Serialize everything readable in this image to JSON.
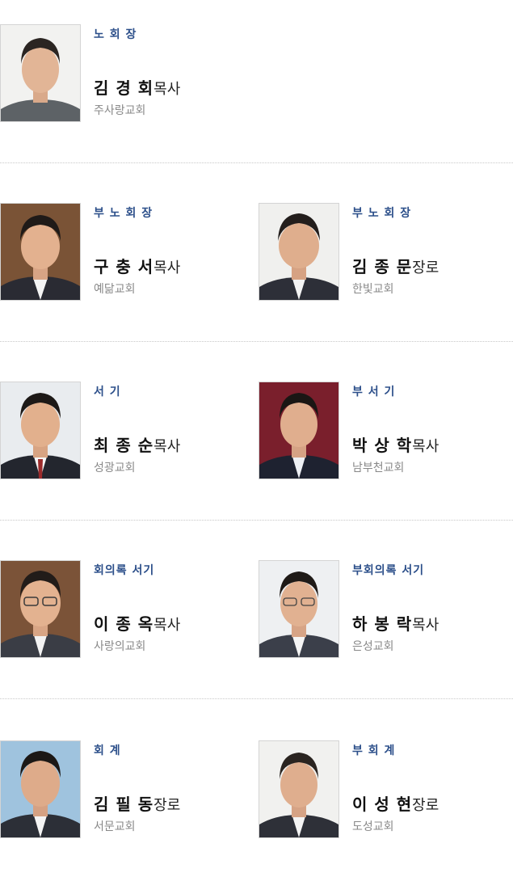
{
  "colors": {
    "role": "#2c4f8a",
    "name": "#111111",
    "church": "#888888",
    "divider": "#c8c8c8"
  },
  "officers": [
    {
      "role": "노 회 장",
      "name": "김 경 회",
      "title": "목사",
      "church": "주사랑교회",
      "photo": "portrait-photo"
    },
    {
      "role": "부 노 회 장",
      "name": "구 충 서",
      "title": "목사",
      "church": "예닮교회",
      "photo": "portrait-photo"
    },
    {
      "role": "부 노 회 장",
      "name": "김 종 문",
      "title": "장로",
      "church": "한빛교회",
      "photo": "portrait-photo"
    },
    {
      "role": "서 기",
      "name": "최 종 순",
      "title": "목사",
      "church": "성광교회",
      "photo": "portrait-photo"
    },
    {
      "role": "부 서 기",
      "name": "박 상 학",
      "title": "목사",
      "church": "남부천교회",
      "photo": "portrait-photo"
    },
    {
      "role": "회의록 서기",
      "name": "이 종 옥",
      "title": "목사",
      "church": "사랑의교회",
      "photo": "portrait-photo"
    },
    {
      "role": "부회의록 서기",
      "name": "하 봉 락",
      "title": "목사",
      "church": "은성교회",
      "photo": "portrait-photo"
    },
    {
      "role": "회 계",
      "name": "김 필 동",
      "title": "장로",
      "church": "서문교회",
      "photo": "portrait-photo"
    },
    {
      "role": "부 회 계",
      "name": "이 성 현",
      "title": "장로",
      "church": "도성교회",
      "photo": "portrait-photo"
    }
  ]
}
